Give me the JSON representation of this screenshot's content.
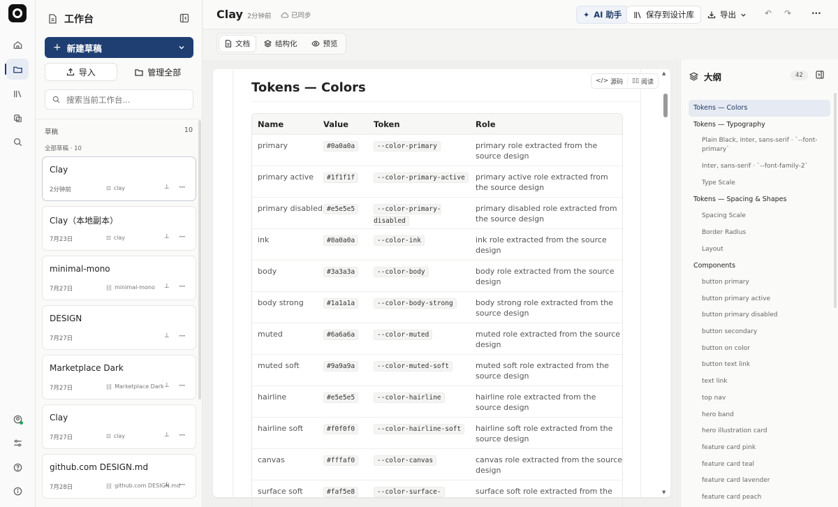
{
  "sidebar": {
    "title": "工作台",
    "new_draft": "新建草稿",
    "import": "导入",
    "manage": "管理全部",
    "search_placeholder": "搜索当前工作台...",
    "drafts_label": "草稿",
    "drafts_count": "10",
    "all_label": "全部草稿 · 10",
    "cards": [
      {
        "title": "Clay",
        "date": "2分钟前",
        "source": "clay"
      },
      {
        "title": "Clay（本地副本）",
        "date": "7月23日",
        "source": "clay"
      },
      {
        "title": "minimal-mono",
        "date": "7月27日",
        "source": "minimal-mono"
      },
      {
        "title": "DESIGN",
        "date": "7月27日",
        "source": ""
      },
      {
        "title": "Marketplace Dark",
        "date": "7月27日",
        "source": "Marketplace Dark"
      },
      {
        "title": "Clay",
        "date": "7月27日",
        "source": "clay"
      },
      {
        "title": "github.com DESIGN.md",
        "date": "7月28日",
        "source": "github.com DESIGN.md"
      }
    ]
  },
  "topbar": {
    "title": "Clay",
    "time": "2分钟前",
    "sync": "已同步",
    "ai": "AI 助手",
    "save": "保存到设计库",
    "export": "导出"
  },
  "modes": {
    "doc": "文档",
    "struct": "结构化",
    "preview": "预览"
  },
  "doc": {
    "src": "源码",
    "read": "阅读",
    "heading": "Tokens — Colors",
    "headers": {
      "name": "Name",
      "value": "Value",
      "token": "Token",
      "role": "Role"
    },
    "rows": [
      {
        "name": "primary",
        "value": "#0a0a0a",
        "token": "--color-primary",
        "role": "primary role extracted from the source design"
      },
      {
        "name": "primary active",
        "value": "#1f1f1f",
        "token": "--color-primary-active",
        "role": "primary active role extracted from the source design"
      },
      {
        "name": "primary disabled",
        "value": "#e5e5e5",
        "token": "--color-primary-disabled",
        "role": "primary disabled role extracted from the source design"
      },
      {
        "name": "ink",
        "value": "#0a0a0a",
        "token": "--color-ink",
        "role": "ink role extracted from the source design"
      },
      {
        "name": "body",
        "value": "#3a3a3a",
        "token": "--color-body",
        "role": "body role extracted from the source design"
      },
      {
        "name": "body strong",
        "value": "#1a1a1a",
        "token": "--color-body-strong",
        "role": "body strong role extracted from the source design"
      },
      {
        "name": "muted",
        "value": "#6a6a6a",
        "token": "--color-muted",
        "role": "muted role extracted from the source design"
      },
      {
        "name": "muted soft",
        "value": "#9a9a9a",
        "token": "--color-muted-soft",
        "role": "muted soft role extracted from the source design"
      },
      {
        "name": "hairline",
        "value": "#e5e5e5",
        "token": "--color-hairline",
        "role": "hairline role extracted from the source design"
      },
      {
        "name": "hairline soft",
        "value": "#f0f0f0",
        "token": "--color-hairline-soft",
        "role": "hairline soft role extracted from the source design"
      },
      {
        "name": "canvas",
        "value": "#fffaf0",
        "token": "--color-canvas",
        "role": "canvas role extracted from the source design"
      },
      {
        "name": "surface soft",
        "value": "#faf5e8",
        "token": "--color-surface-",
        "role": "surface soft role extracted from the"
      }
    ]
  },
  "outline": {
    "title": "大纲",
    "count": "42",
    "items": [
      {
        "label": "Tokens — Colors",
        "level": 1,
        "active": true
      },
      {
        "label": "Tokens — Typography",
        "level": 1
      },
      {
        "label": "Plain Black, Inter, sans-serif · `--font-primary`",
        "level": 2
      },
      {
        "label": "Inter, sans-serif · `--font-family-2`",
        "level": 2
      },
      {
        "label": "Type Scale",
        "level": 2
      },
      {
        "label": "Tokens — Spacing & Shapes",
        "level": 1
      },
      {
        "label": "Spacing Scale",
        "level": 2
      },
      {
        "label": "Border Radius",
        "level": 2
      },
      {
        "label": "Layout",
        "level": 2
      },
      {
        "label": "Components",
        "level": 1
      },
      {
        "label": "button primary",
        "level": 2
      },
      {
        "label": "button primary active",
        "level": 2
      },
      {
        "label": "button primary disabled",
        "level": 2
      },
      {
        "label": "button secondary",
        "level": 2
      },
      {
        "label": "button on color",
        "level": 2
      },
      {
        "label": "button text link",
        "level": 2
      },
      {
        "label": "text link",
        "level": 2
      },
      {
        "label": "top nav",
        "level": 2
      },
      {
        "label": "hero band",
        "level": 2
      },
      {
        "label": "hero illustration card",
        "level": 2
      },
      {
        "label": "feature card pink",
        "level": 2
      },
      {
        "label": "feature card teal",
        "level": 2
      },
      {
        "label": "feature card lavender",
        "level": 2
      },
      {
        "label": "feature card peach",
        "level": 2
      }
    ]
  }
}
